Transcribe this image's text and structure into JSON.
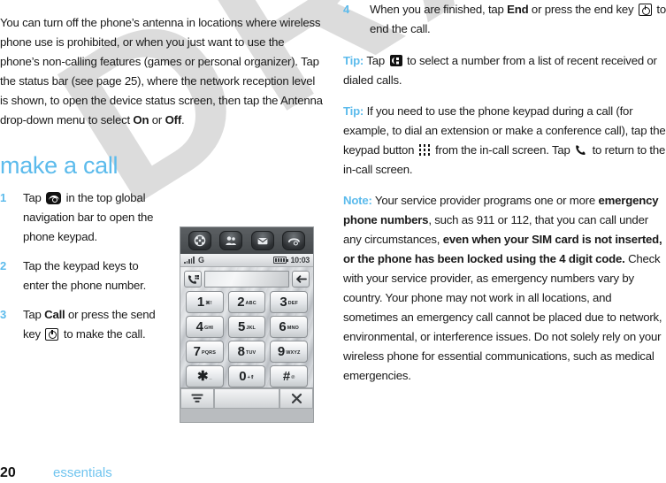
{
  "colors": {
    "accent_blue": "#5cbbec",
    "footer_blue": "#6fc4ef",
    "body_text": "#1a1a1a",
    "watermark": "#dcdcdc"
  },
  "watermark": {
    "text": "DRAFT"
  },
  "left_column": {
    "intro_paragraph": {
      "part1": "You can turn off the phone’s antenna in locations where wireless phone use is prohibited, or when you just want to use the phone’s non-calling features (games or personal organizer). Tap the status bar (see page 25), where the network reception level is shown, to open the device status screen, then tap the Antenna drop-down menu to select ",
      "bold_on": "On",
      "conjunction": " or ",
      "bold_off": "Off",
      "part_end": "."
    },
    "section_title": "make a call",
    "steps": [
      {
        "num": "1",
        "text_before_icon": "Tap ",
        "icon": "phone-filled-icon",
        "text_after_icon": " in the top global navigation bar to open the phone keypad."
      },
      {
        "num": "2",
        "text_before_icon": "Tap the keypad keys to enter the phone number.",
        "icon": "",
        "text_after_icon": ""
      },
      {
        "num": "3",
        "text_before_icon": "Tap ",
        "bold_word": "Call",
        "text_mid": " or press the send key ",
        "icon": "send-key-icon",
        "text_after_icon": " to make the call."
      }
    ]
  },
  "phone_screenshot": {
    "nav_icons": [
      "apps-grid-icon",
      "contacts-icon",
      "messaging-envelope-icon",
      "phone-handset-icon"
    ],
    "status_bar": {
      "signal": "signal-bars-icon",
      "network": "G",
      "battery": "battery-icon",
      "time": "10:03"
    },
    "dial_field_value": "",
    "left_dial_button": "recent-calls-icon",
    "right_dial_button": "backspace-arrow-icon",
    "keys": [
      {
        "digit": "1",
        "letters": "⌘!"
      },
      {
        "digit": "2",
        "letters": "ABC"
      },
      {
        "digit": "3",
        "letters": "DEF"
      },
      {
        "digit": "4",
        "letters": "GHI"
      },
      {
        "digit": "5",
        "letters": "JKL"
      },
      {
        "digit": "6",
        "letters": "MNO"
      },
      {
        "digit": "7",
        "letters": "PQRS"
      },
      {
        "digit": "8",
        "letters": "TUV"
      },
      {
        "digit": "9",
        "letters": "WXYZ"
      },
      {
        "digit": "✱",
        "letters": "_"
      },
      {
        "digit": "0",
        "letters": "+⇑"
      },
      {
        "digit": "#",
        "letters": "℗"
      }
    ],
    "soft_keys": {
      "left": "menu-icon",
      "middle": "",
      "right": "close-icon"
    }
  },
  "right_column": {
    "step4": {
      "num": "4",
      "text_before_bold": "When you are finished, tap ",
      "bold_word": "End",
      "text_mid": " or press the end key ",
      "icon": "end-key-icon",
      "text_after_icon": " to end the call."
    },
    "tip1": {
      "label": "Tip:",
      "text_before_icon": " Tap ",
      "icon": "recent-calls-icon",
      "text_after_icon": " to select a number from a list of recent received or dialed calls."
    },
    "tip2": {
      "label": "Tip:",
      "text_before_icon": " If you need to use the phone keypad during a call (for example, to dial an extension or make a conference call), tap the keypad button ",
      "icon": "keypad-grid-icon",
      "text_mid": " from the in-call screen. Tap ",
      "icon2": "handset-icon",
      "text_after_icon": " to return to the in-call screen."
    },
    "note": {
      "label": "Note:",
      "p1": " Your service provider programs one or more ",
      "b1": "emergency phone numbers",
      "p2": ", such as 911 or 112, that you can call under any circumstances, ",
      "b2": "even when your SIM card is not inserted, or the phone has been locked using the 4 digit code.",
      "p3": " Check with your service provider, as emergency numbers vary by country. Your phone may not work in all locations, and sometimes an emergency call cannot be placed due to network, environmental, or interference issues. Do not solely rely on your wireless phone for essential communications, such as medical emergencies."
    }
  },
  "footer": {
    "page_number": "20",
    "section": "essentials"
  }
}
